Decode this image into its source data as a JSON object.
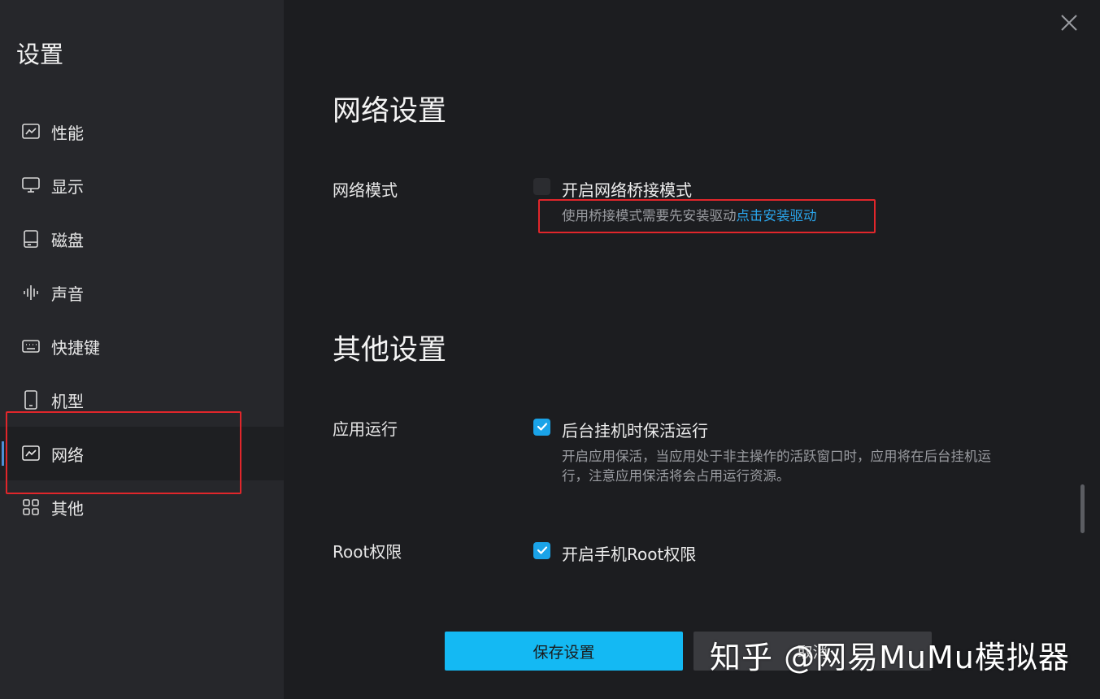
{
  "sidebar": {
    "title": "设置",
    "items": [
      {
        "label": "性能",
        "icon": "chart-line-icon"
      },
      {
        "label": "显示",
        "icon": "monitor-icon"
      },
      {
        "label": "磁盘",
        "icon": "disk-icon"
      },
      {
        "label": "声音",
        "icon": "audio-wave-icon"
      },
      {
        "label": "快捷键",
        "icon": "keyboard-icon"
      },
      {
        "label": "机型",
        "icon": "phone-icon"
      },
      {
        "label": "网络",
        "icon": "chart-line-icon",
        "active": true
      },
      {
        "label": "其他",
        "icon": "grid-icon"
      }
    ]
  },
  "network": {
    "section_title": "网络设置",
    "mode_label": "网络模式",
    "bridge_checkbox_label": "开启网络桥接模式",
    "bridge_checked": false,
    "bridge_help": "使用桥接模式需要先安装驱动",
    "bridge_help_link": "点击安装驱动"
  },
  "other": {
    "section_title": "其他设置",
    "app_run_label": "应用运行",
    "keepalive_checkbox_label": "后台挂机时保活运行",
    "keepalive_checked": true,
    "keepalive_help_line1": "开启应用保活，当应用处于非主操作的活跃窗口时，应用将在后台挂机运",
    "keepalive_help_line2": "行，注意应用保活将会占用运行资源。",
    "root_label": "Root权限",
    "root_checkbox_label": "开启手机Root权限",
    "root_checked": true
  },
  "footer": {
    "save_label": "保存设置",
    "cancel_label": "取消"
  },
  "watermark": "知乎 @网易MuMu模拟器",
  "colors": {
    "accent": "#14b9f3",
    "link": "#2aa7ee",
    "highlight_box": "#e1262b",
    "sidebar_bg": "#26272b",
    "main_bg": "#1c1d20"
  }
}
